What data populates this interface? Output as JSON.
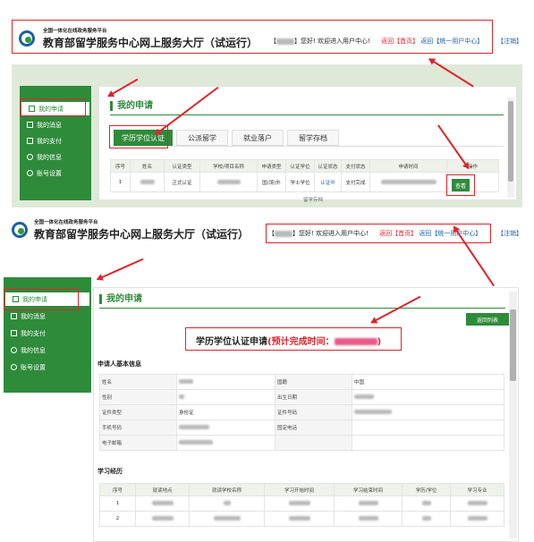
{
  "header": {
    "platform_subtitle": "全国一体化在线政务服务平台",
    "site_title": "教育部留学服务中心网上服务大厅（试运行）",
    "greeting": "您好! 欢迎进入用户中心!",
    "link_back": "返回",
    "link_home": "【首页】",
    "link_back2": "返回",
    "link_user_center": "【统一用户中心】",
    "link_logout": "【注销】"
  },
  "sidebar": {
    "items": [
      {
        "label": "我的申请",
        "icon": "document-icon"
      },
      {
        "label": "我的消息",
        "icon": "speaker-icon"
      },
      {
        "label": "我的支付",
        "icon": "card-icon"
      },
      {
        "label": "我的信息",
        "icon": "user-icon"
      },
      {
        "label": "账号设置",
        "icon": "gear-icon"
      }
    ]
  },
  "top": {
    "section_title": "我的申请",
    "tabs": [
      "学历学位认证",
      "公派留学",
      "就业落户",
      "留学存档"
    ],
    "table": {
      "headers": [
        "序号",
        "姓名",
        "认证类型",
        "学校/项目名称",
        "申请类型",
        "认证学位",
        "认证状态",
        "支付状态",
        "申请时间",
        "操作"
      ],
      "row": [
        "1",
        "",
        "正式认证",
        "",
        "国(境)外",
        "学士学位",
        "认证中",
        "支付完成",
        "",
        "查看"
      ],
      "partial_next_row": "留学存档"
    }
  },
  "bottom": {
    "section_title": "我的申请",
    "back_list_button": "返回列表",
    "app_title": "学历学位认证申请",
    "estimated_label": "(预计完成时间：",
    "estimated_close": ")",
    "basic_info_title": "申请人基本信息",
    "basic_info": [
      {
        "l1": "姓名",
        "v1": "",
        "l2": "国籍",
        "v2": "中国"
      },
      {
        "l1": "性别",
        "v1": "",
        "l2": "出生日期",
        "v2": ""
      },
      {
        "l1": "证件类型",
        "v1": "身份证",
        "l2": "证件号码",
        "v2": ""
      },
      {
        "l1": "手机号码",
        "v1": "",
        "l2": "固定电话",
        "v2": ""
      },
      {
        "l1": "电子邮箱",
        "v1": "",
        "l2": "",
        "v2": ""
      }
    ],
    "study_title": "学习经历",
    "study_headers": [
      "序号",
      "就读地点",
      "就读学校名称",
      "学习开始时间",
      "学习结束时间",
      "学历/学位",
      "学习专业"
    ],
    "study_rows": [
      "1",
      "2"
    ]
  },
  "colors": {
    "accent_green": "#2e8b3a",
    "annotation_red": "#e0232b",
    "link_blue": "#1d5fa5"
  }
}
